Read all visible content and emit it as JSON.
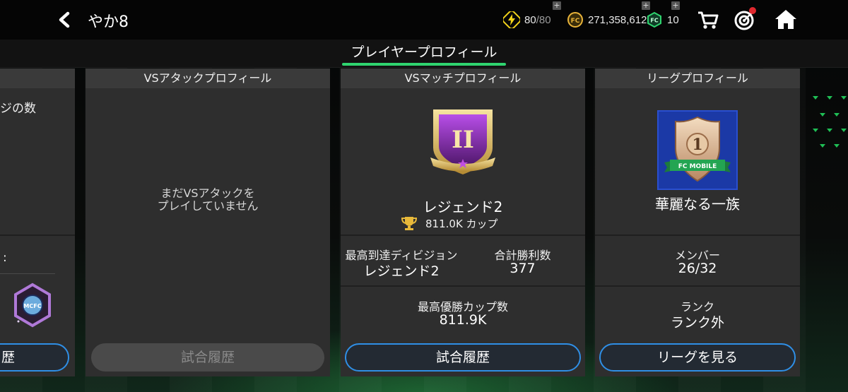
{
  "header": {
    "title": "やか8",
    "energy": {
      "current": "80",
      "max": "/80"
    },
    "coins": "271,358,612",
    "gems": "10"
  },
  "tabs": {
    "active": "プレイヤープロフィール"
  },
  "left_panel": {
    "partial_text": "ジの数",
    "colon": ":",
    "button": "歴"
  },
  "vs_attack": {
    "title": "VSアタックプロフィール",
    "empty_line1": "まだVSアタックを",
    "empty_line2": "プレイしていません",
    "button": "試合履歴"
  },
  "vs_match": {
    "title": "VSマッチプロフィール",
    "rank_name": "レジェンド2",
    "cups": "811.0K カップ",
    "best_division_label": "最高到達ディビジョン",
    "best_division_value": "レジェンド2",
    "total_wins_label": "合計勝利数",
    "total_wins_value": "377",
    "max_cups_label": "最高優勝カップ数",
    "max_cups_value": "811.9K",
    "button": "試合履歴",
    "badge_numeral": "II"
  },
  "league": {
    "title": "リーグプロフィール",
    "league_name": "華麗なる一族",
    "badge_number": "1",
    "badge_ribbon": "FC MOBILE",
    "members_label": "メンバー",
    "members_value": "26/32",
    "rank_label": "ランク",
    "rank_value": "ランク外",
    "button": "リーグを見る"
  },
  "colors": {
    "accent_green": "#2fd46f",
    "button_border_blue": "#2f8fe6",
    "notification_red": "#e0282e",
    "energy_yellow": "#f2d21a"
  }
}
